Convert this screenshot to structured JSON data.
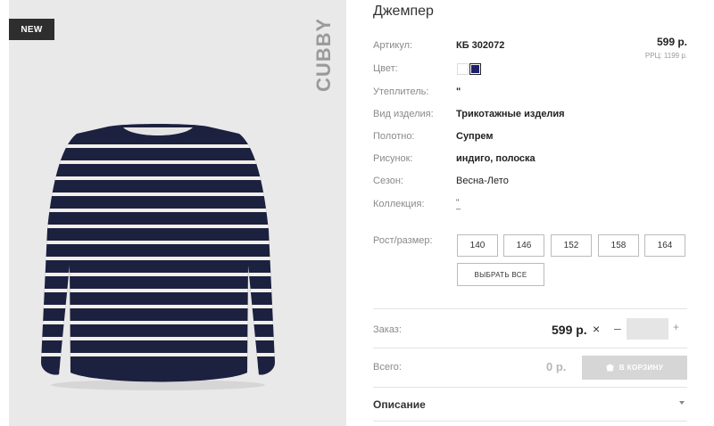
{
  "photo": {
    "badge": "NEW",
    "brand": "CUBBY"
  },
  "product": {
    "title": "Джемпер",
    "price": "599 р.",
    "rrp": "РРЦ: 1199 р.",
    "colors": [
      {
        "name": "white",
        "hex": "#ffffff"
      },
      {
        "name": "navy",
        "hex": "#1f1f6b"
      }
    ],
    "attributes": [
      {
        "label": "Артикул:",
        "value": "КБ 302072"
      },
      {
        "label": "Цвет:",
        "value": ""
      },
      {
        "label": "Утеплитель:",
        "value": "\""
      },
      {
        "label": "Вид изделия:",
        "value": "Трикотажные изделия"
      },
      {
        "label": "Полотно:",
        "value": "Супрем"
      },
      {
        "label": "Рисунок:",
        "value": "индиго, полоска"
      },
      {
        "label": "Сезон:",
        "value": "Весна-Лето"
      },
      {
        "label": "Коллекция:",
        "value": "\""
      }
    ]
  },
  "sizes": {
    "label": "Рост/размер:",
    "options": [
      "140",
      "146",
      "152",
      "158",
      "164"
    ],
    "select_all": "ВЫБРАТЬ ВСЕ"
  },
  "order": {
    "label": "Заказ:",
    "price": "599 р.",
    "times": "×",
    "minus": "–",
    "quantity": "",
    "plus": "+"
  },
  "total": {
    "label": "Всего:",
    "value": "0 р.",
    "cart_button": "В КОРЗИНУ"
  },
  "description": {
    "label": "Описание"
  }
}
